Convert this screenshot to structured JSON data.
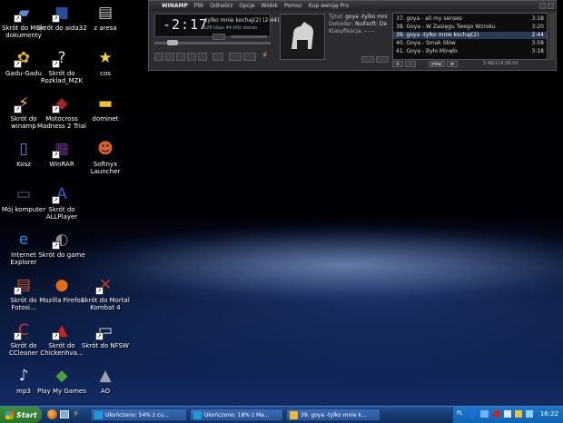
{
  "desktop": {
    "icons": [
      {
        "label": "Skrót do Moje dokumenty"
      },
      {
        "label": "Skrót do aida32"
      },
      {
        "label": "z aresa"
      },
      {
        "label": "Gadu-Gadu"
      },
      {
        "label": "Skrót do Rozklad_MZK"
      },
      {
        "label": "cos"
      },
      {
        "label": "Skrót do winamp"
      },
      {
        "label": "Motocross Madness 2 Trial"
      },
      {
        "label": "dominet"
      },
      {
        "label": "Kosz"
      },
      {
        "label": "WinRAR"
      },
      {
        "label": "Softnyx Launcher"
      },
      {
        "label": "Mój komputer"
      },
      {
        "label": "Skrót do ALLPlayer"
      },
      {
        "label": "Internet Explorer"
      },
      {
        "label": "Skrót do game"
      },
      {
        "label": "Skrót do Fotosi..."
      },
      {
        "label": "Mozilla Firefox"
      },
      {
        "label": "Skrót do Mortal Kombat 4"
      },
      {
        "label": "Skrót do CCleaner"
      },
      {
        "label": "Skrót do Chickenhva..."
      },
      {
        "label": "Skrót do NFSW"
      },
      {
        "label": "mp3"
      },
      {
        "label": "Play My Games"
      },
      {
        "label": "AO"
      }
    ]
  },
  "winamp": {
    "brand": "WINAMP",
    "menu": [
      "Plik",
      "Odtwórz",
      "Opcje",
      "Widok",
      "Pomoc",
      "Kup wersję Pro"
    ],
    "time": "-2:17",
    "now_playing": "-tylko mnie kochaj(2) (2:44)",
    "stream_info": "128 kbps   44 kHz   stereo",
    "meta": {
      "title_label": "Tytuł:",
      "title_value": "goya -tylko mni",
      "decoder_label": "Dekoder:",
      "decoder_value": "Nullsoft: De",
      "class_label": "Klasyfikacja:",
      "class_value": "- - -"
    },
    "playlist": [
      {
        "name": "37. goya - all my senses",
        "time": "3:18"
      },
      {
        "name": "38. Goya - W Zasięgu Twego Wzroku",
        "time": "3:20"
      },
      {
        "name": "39. goya -tylko mnie kochaj(2)",
        "time": "2:44"
      },
      {
        "name": "40. Goya - Smak Słów",
        "time": "3:58"
      },
      {
        "name": "41. Goya - Było Minęło",
        "time": "3:18"
      }
    ],
    "playlist_footer": "5:48/114:36:03",
    "playlist_buttons": [
      "+",
      "-",
      "misc",
      "≡"
    ]
  },
  "taskbar": {
    "start": "Start",
    "tasks": [
      {
        "label": "Ukończono: 54% z cu..."
      },
      {
        "label": "Ukończono: 18% z Ma..."
      },
      {
        "label": "39. goya -tylko mnie k..."
      }
    ],
    "lang": "PL",
    "clock": "16:22"
  },
  "colors": {
    "taskbar": "#163d75",
    "start": "#2a722a",
    "tray": "#1163b2",
    "winamp_bg": "#2b2d30"
  }
}
